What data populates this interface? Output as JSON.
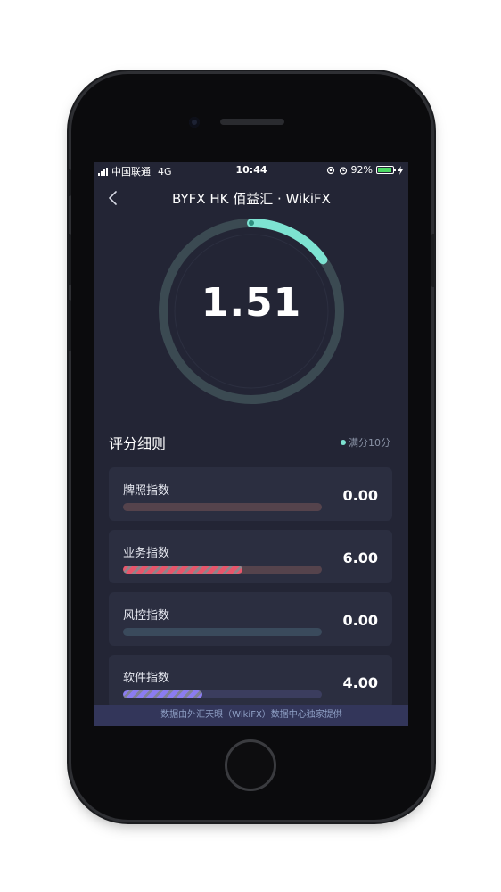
{
  "status_bar": {
    "carrier": "中国联通",
    "network": "4G",
    "time": "10:44",
    "battery": "92%",
    "battery_level": 0.92
  },
  "nav": {
    "back_icon": "chevron-left-icon",
    "title": "BYFX HK 佰益汇 · WikiFX"
  },
  "score": {
    "value": "1.51",
    "max": 10,
    "progress": 0.151,
    "accent": "#7de2d1"
  },
  "breakdown": {
    "title": "评分细则",
    "legend": "满分10分",
    "items": [
      {
        "label": "牌照指数",
        "value": "0.00",
        "progress": 0.0,
        "track": "#55434c",
        "color": "#e8566c"
      },
      {
        "label": "业务指数",
        "value": "6.00",
        "progress": 0.6,
        "track": "#55434c",
        "color": "#e8566c"
      },
      {
        "label": "风控指数",
        "value": "0.00",
        "progress": 0.0,
        "track": "#3a4a5c",
        "color": "#5aa0c8"
      },
      {
        "label": "软件指数",
        "value": "4.00",
        "progress": 0.4,
        "track": "#3b3d5e",
        "color": "#8b7cf0"
      }
    ]
  },
  "footer": {
    "text": "数据由外汇天眼（WikiFX）数据中心独家提供"
  }
}
